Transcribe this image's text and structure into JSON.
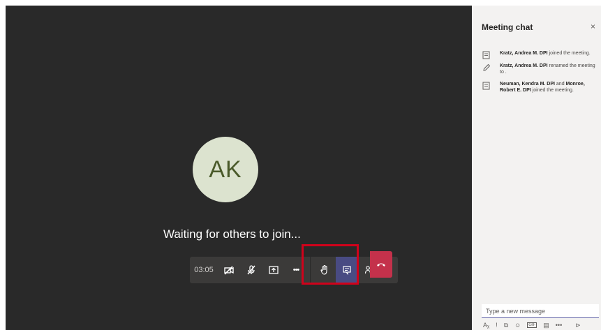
{
  "stage": {
    "avatar_initials": "AK",
    "waiting_text": "Waiting for others to join..."
  },
  "toolbar": {
    "timer": "03:05",
    "buttons": [
      {
        "id": "camera",
        "icon": "camera-off-icon"
      },
      {
        "id": "mic",
        "icon": "mic-off-icon"
      },
      {
        "id": "share",
        "icon": "share-screen-icon"
      },
      {
        "id": "more",
        "icon": "more-icon"
      },
      {
        "id": "raise-hand",
        "icon": "raise-hand-icon"
      },
      {
        "id": "chat",
        "icon": "chat-icon"
      },
      {
        "id": "participants",
        "icon": "participants-icon"
      },
      {
        "id": "hangup",
        "icon": "hangup-icon"
      }
    ],
    "more_label": "•••"
  },
  "chat": {
    "title": "Meeting chat",
    "close": "×",
    "messages": [
      {
        "bold1": "Kratz, Andrea M. DPI",
        "rest": " joined the meeting."
      },
      {
        "bold1": "Kratz, Andrea M. DPI",
        "rest": " renamed the meeting to ."
      },
      {
        "bold1": "Neuman, Kendra M. DPI",
        "mid": " and ",
        "bold2": "Monroe, Robert E. DPI",
        "rest": " joined the meeting."
      }
    ],
    "composer_placeholder": "Type a new message",
    "format_icons": [
      "Aᵪ",
      "!",
      "⧉",
      "☺",
      "GIF",
      "▤",
      "•••",
      "⊳"
    ]
  },
  "colors": {
    "stage_bg": "#292929",
    "toolbar_bg": "#3b3a39",
    "active_btn": "#494b83",
    "hangup": "#c4314b",
    "highlight": "#d0021b",
    "chat_bg": "#f3f2f1"
  }
}
